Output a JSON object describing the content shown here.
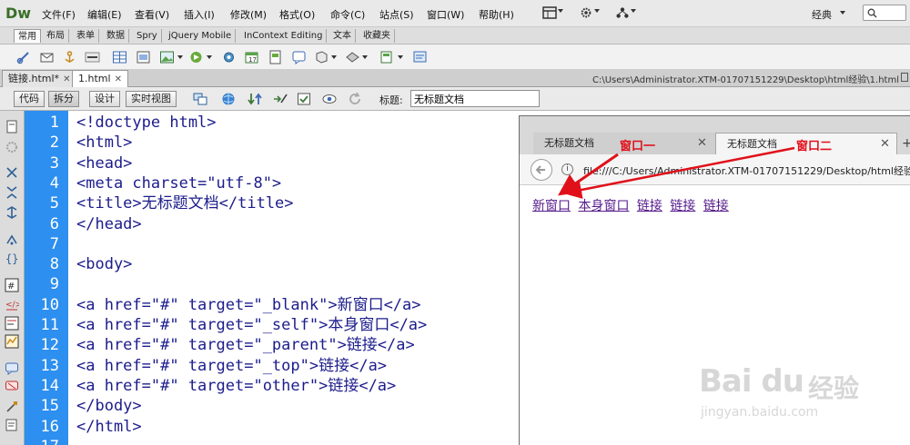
{
  "app": {
    "logo": "Dw",
    "menus": [
      "文件(F)",
      "编辑(E)",
      "查看(V)",
      "插入(I)",
      "修改(M)",
      "格式(O)",
      "命令(C)",
      "站点(S)",
      "窗口(W)",
      "帮助(H)"
    ],
    "workspace": "经典"
  },
  "insert_tabs": [
    "常用",
    "布局",
    "表单",
    "数据",
    "Spry",
    "jQuery Mobile",
    "InContext Editing",
    "文本",
    "收藏夹"
  ],
  "doc_tabs": [
    {
      "label": "链接.html*"
    },
    {
      "label": "1.html"
    }
  ],
  "file_path": "C:\\Users\\Administrator.XTM-01707151229\\Desktop\\html经验\\1.html",
  "view_buttons": [
    "代码",
    "拆分",
    "设计",
    "实时视图"
  ],
  "title_field": {
    "label": "标题:",
    "value": "无标题文档"
  },
  "code_lines": [
    {
      "n": "1",
      "text": "<!doctype html>"
    },
    {
      "n": "2",
      "text": "<html>"
    },
    {
      "n": "3",
      "text": "<head>"
    },
    {
      "n": "4",
      "text": "<meta charset=\"utf-8\">"
    },
    {
      "n": "5",
      "text": "<title>无标题文档</title>"
    },
    {
      "n": "6",
      "text": "</head>"
    },
    {
      "n": "7",
      "text": ""
    },
    {
      "n": "8",
      "text": "<body>"
    },
    {
      "n": "9",
      "text": ""
    },
    {
      "n": "10",
      "text": "<a href=\"#\" target=\"_blank\">新窗口</a>"
    },
    {
      "n": "11",
      "text": "<a href=\"#\" target=\"_self\">本身窗口</a>"
    },
    {
      "n": "12",
      "text": "<a href=\"#\" target=\"_parent\">链接</a>"
    },
    {
      "n": "13",
      "text": "<a href=\"#\" target=\"_top\">链接</a>"
    },
    {
      "n": "14",
      "text": "<a href=\"#\" target=\"other\">链接</a>"
    },
    {
      "n": "15",
      "text": "</body>"
    },
    {
      "n": "16",
      "text": "</html>"
    },
    {
      "n": "17",
      "text": ""
    }
  ],
  "browser": {
    "tabs": [
      {
        "label": "无标题文档"
      },
      {
        "label": "无标题文档"
      }
    ],
    "url": "file:///C:/Users/Administrator.XTM-01707151229/Desktop/html经验",
    "links": [
      "新窗口",
      "本身窗口",
      "链接",
      "链接",
      "链接"
    ]
  },
  "annotations": {
    "window1": "窗口一",
    "window2": "窗口二"
  },
  "watermark": {
    "logo": "Bai du",
    "cn": "经验",
    "url": "jingyan.baidu.com"
  },
  "colors": {
    "gutter": "#2d8fef",
    "code_text": "#1c1c8c",
    "annotation": "#e0101a",
    "link_visited": "#551a8b"
  }
}
